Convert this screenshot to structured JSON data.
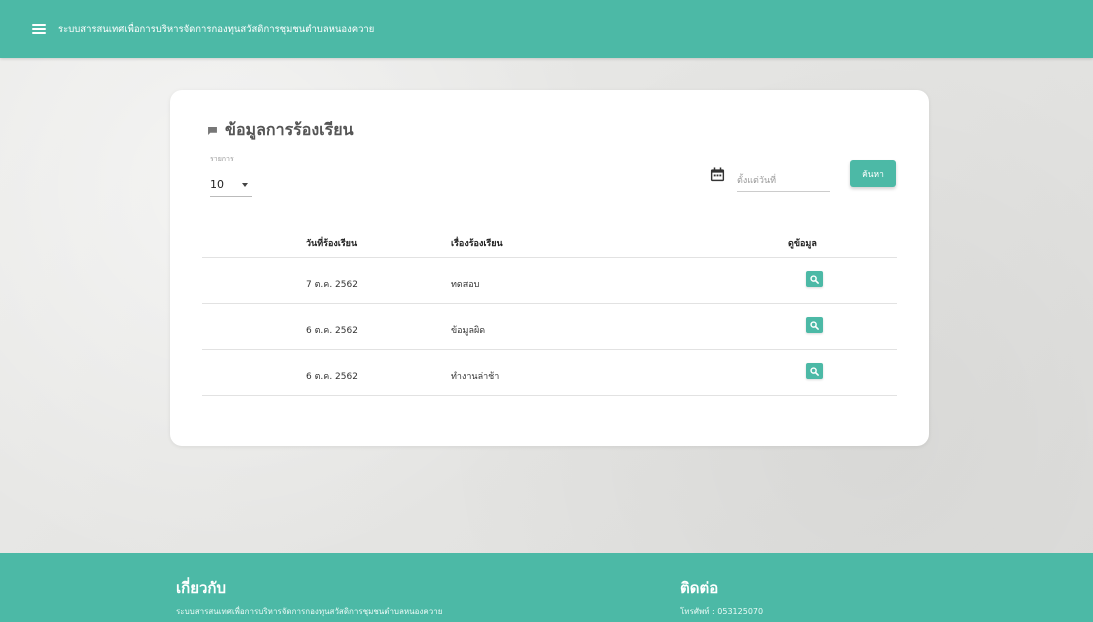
{
  "header": {
    "title": "ระบบสารสนเทศเพื่อการบริหารจัดการกองทุนสวัสดิการชุมชนตำบลหนองควาย",
    "menu_icon": "menu-icon"
  },
  "card": {
    "title": "ข้อมูลการร้องเรียน",
    "title_icon": "comment-icon",
    "per_page": {
      "label": "รายการ",
      "value": "10"
    },
    "date_filter": {
      "icon": "calendar-icon",
      "placeholder": "ตั้งแต่วันที่",
      "value": ""
    },
    "search_label": "ค้นหา"
  },
  "table": {
    "columns": [
      "วันที่ร้องเรียน",
      "เรื่องร้องเรียน",
      "ดูข้อมูล"
    ],
    "rows": [
      {
        "date": "7 ต.ค. 2562",
        "subject": "ทดสอบ"
      },
      {
        "date": "6 ต.ค. 2562",
        "subject": "ข้อมูลผิด"
      },
      {
        "date": "6 ต.ค. 2562",
        "subject": "ทำงานล่าช้า"
      }
    ]
  },
  "footer": {
    "about_title": "เกี่ยวกับ",
    "about_text": "ระบบสารสนเทศเพื่อการบริหารจัดการกองทุนสวัสดิการชุมชนตำบลหนองควาย",
    "contact_title": "ติดต่อ",
    "contact_text": "โทรศัพท์ : 053125070"
  },
  "colors": {
    "primary": "#4cb9a6",
    "background": "#e6e6e4",
    "card": "#ffffff"
  }
}
